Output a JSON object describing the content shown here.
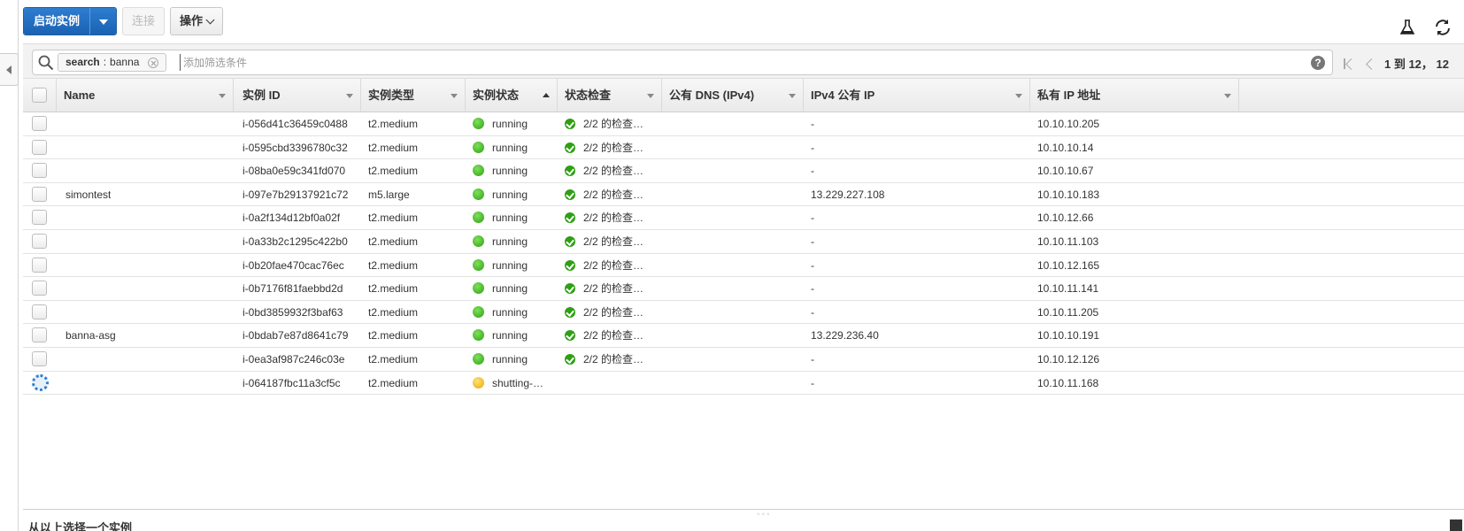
{
  "toolbar": {
    "launch_label": "启动实例",
    "connect_label": "连接",
    "actions_label": "操作"
  },
  "filter": {
    "token_key": "search",
    "token_sep": " : ",
    "token_value": "banna",
    "placeholder": "添加筛选条件"
  },
  "pager": {
    "text": "1 到 12， 12"
  },
  "columns": [
    "Name",
    "实例 ID",
    "实例类型",
    "实例状态",
    "状态检查",
    "公有 DNS (IPv4)",
    "IPv4 公有 IP",
    "私有 IP 地址"
  ],
  "rows": [
    {
      "name": "",
      "id": "i-056d41c36459c0488",
      "type": "t2.medium",
      "state": "running",
      "state_color": "green",
      "check": "2/2 的检查…",
      "dns": "",
      "public_ip": "-",
      "private_ip": "10.10.10.205"
    },
    {
      "name": "",
      "id": "i-0595cbd3396780c32",
      "type": "t2.medium",
      "state": "running",
      "state_color": "green",
      "check": "2/2 的检查…",
      "dns": "",
      "public_ip": "-",
      "private_ip": "10.10.10.14"
    },
    {
      "name": "",
      "id": "i-08ba0e59c341fd070",
      "type": "t2.medium",
      "state": "running",
      "state_color": "green",
      "check": "2/2 的检查…",
      "dns": "",
      "public_ip": "-",
      "private_ip": "10.10.10.67"
    },
    {
      "name": "simontest",
      "id": "i-097e7b29137921c72",
      "type": "m5.large",
      "state": "running",
      "state_color": "green",
      "check": "2/2 的检查…",
      "dns": "",
      "public_ip": "13.229.227.108",
      "private_ip": "10.10.10.183"
    },
    {
      "name": "",
      "id": "i-0a2f134d12bf0a02f",
      "type": "t2.medium",
      "state": "running",
      "state_color": "green",
      "check": "2/2 的检查…",
      "dns": "",
      "public_ip": "-",
      "private_ip": "10.10.12.66"
    },
    {
      "name": "",
      "id": "i-0a33b2c1295c422b0",
      "type": "t2.medium",
      "state": "running",
      "state_color": "green",
      "check": "2/2 的检查…",
      "dns": "",
      "public_ip": "-",
      "private_ip": "10.10.11.103"
    },
    {
      "name": "",
      "id": "i-0b20fae470cac76ec",
      "type": "t2.medium",
      "state": "running",
      "state_color": "green",
      "check": "2/2 的检查…",
      "dns": "",
      "public_ip": "-",
      "private_ip": "10.10.12.165"
    },
    {
      "name": "",
      "id": "i-0b7176f81faebbd2d",
      "type": "t2.medium",
      "state": "running",
      "state_color": "green",
      "check": "2/2 的检查…",
      "dns": "",
      "public_ip": "-",
      "private_ip": "10.10.11.141"
    },
    {
      "name": "",
      "id": "i-0bd3859932f3baf63",
      "type": "t2.medium",
      "state": "running",
      "state_color": "green",
      "check": "2/2 的检查…",
      "dns": "",
      "public_ip": "-",
      "private_ip": "10.10.11.205"
    },
    {
      "name": "banna-asg",
      "id": "i-0bdab7e87d8641c79",
      "type": "t2.medium",
      "state": "running",
      "state_color": "green",
      "check": "2/2 的检查…",
      "dns": "",
      "public_ip": "13.229.236.40",
      "private_ip": "10.10.10.191"
    },
    {
      "name": "",
      "id": "i-0ea3af987c246c03e",
      "type": "t2.medium",
      "state": "running",
      "state_color": "green",
      "check": "2/2 的检查…",
      "dns": "",
      "public_ip": "-",
      "private_ip": "10.10.12.126"
    },
    {
      "name": "",
      "id": "i-064187fbc11a3cf5c",
      "type": "t2.medium",
      "state": "shutting-…",
      "state_color": "yellow",
      "check": "",
      "dns": "",
      "public_ip": "-",
      "private_ip": "10.10.11.168",
      "loading": true
    }
  ],
  "bottom": {
    "select_hint": "从以上选择一个实例"
  },
  "colors": {
    "primary": "#1a62b3",
    "running": "#2f9f14",
    "shutting": "#e6a800"
  },
  "icons": [
    "search-icon",
    "clear-token-icon",
    "help-icon",
    "first-page-icon",
    "prev-page-icon",
    "flask-icon",
    "refresh-icon",
    "dropdown-caret-icon"
  ]
}
